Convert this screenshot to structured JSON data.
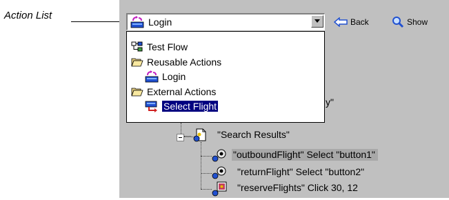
{
  "callout": {
    "label": "Action List"
  },
  "combo": {
    "value": "Login"
  },
  "toolbar": {
    "back_label": "Back",
    "show_label": "Show"
  },
  "dropdown": {
    "items": [
      {
        "label": "Test Flow",
        "icon": "test-flow-icon"
      },
      {
        "label": "Reusable Actions",
        "icon": "folder-open-icon"
      },
      {
        "label": "Login",
        "icon": "action-icon"
      },
      {
        "label": "External Actions",
        "icon": "folder-open-icon"
      },
      {
        "label": "Select Flight",
        "icon": "external-action-icon",
        "selected": true
      }
    ]
  },
  "tree": {
    "partial_text": "y\"",
    "items": [
      {
        "label": "\"Search Results\"",
        "icon": "page-icon"
      },
      {
        "label": "\"outboundFlight\" Select \"button1\"",
        "icon": "radio-object-icon",
        "highlighted": true
      },
      {
        "label": "\"returnFlight\" Select \"button2\"",
        "icon": "radio-object-icon"
      },
      {
        "label": "\"reserveFlights\" Click 30, 12",
        "icon": "image-object-icon"
      }
    ]
  },
  "colors": {
    "panel": "#c0c0c0",
    "selection": "#000080",
    "highlight": "#a8a8a8"
  }
}
